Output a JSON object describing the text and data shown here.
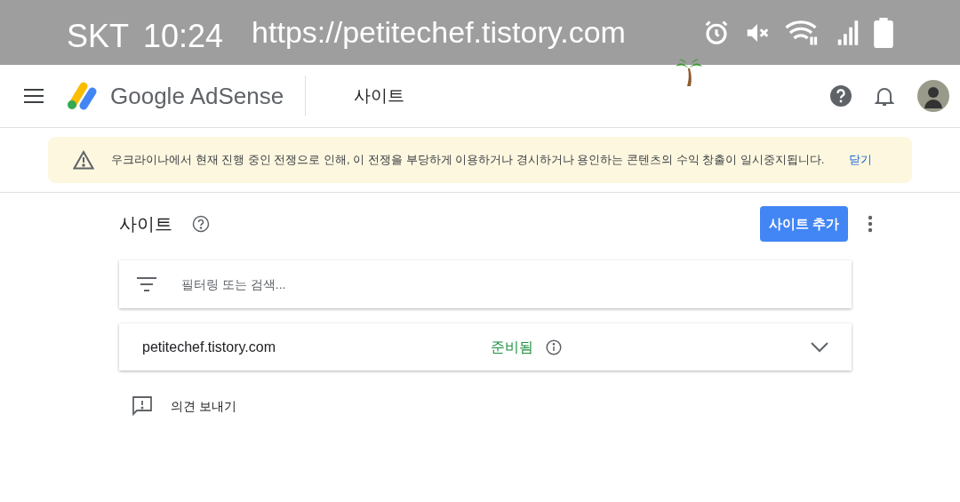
{
  "status_bar": {
    "carrier": "SKT",
    "time": "10:24",
    "url": "https://petitechef.tistory.com"
  },
  "header": {
    "product_first": "Google",
    "product_second": "AdSense",
    "page_title": "사이트"
  },
  "banner": {
    "message": "우크라이나에서 현재 진행 중인 전쟁으로 인해, 이 전쟁을 부당하게 이용하거나 경시하거나 용인하는 콘텐츠의 수익 창출이 일시중지됩니다.",
    "dismiss": "닫기"
  },
  "page": {
    "title": "사이트",
    "add_button": "사이트 추가"
  },
  "filter": {
    "placeholder": "필터링 또는 검색..."
  },
  "sites": [
    {
      "domain": "petitechef.tistory.com",
      "status": "준비됨",
      "color": "#1e8e3e",
      "expanded": false
    }
  ],
  "feedback": "의견 보내기"
}
